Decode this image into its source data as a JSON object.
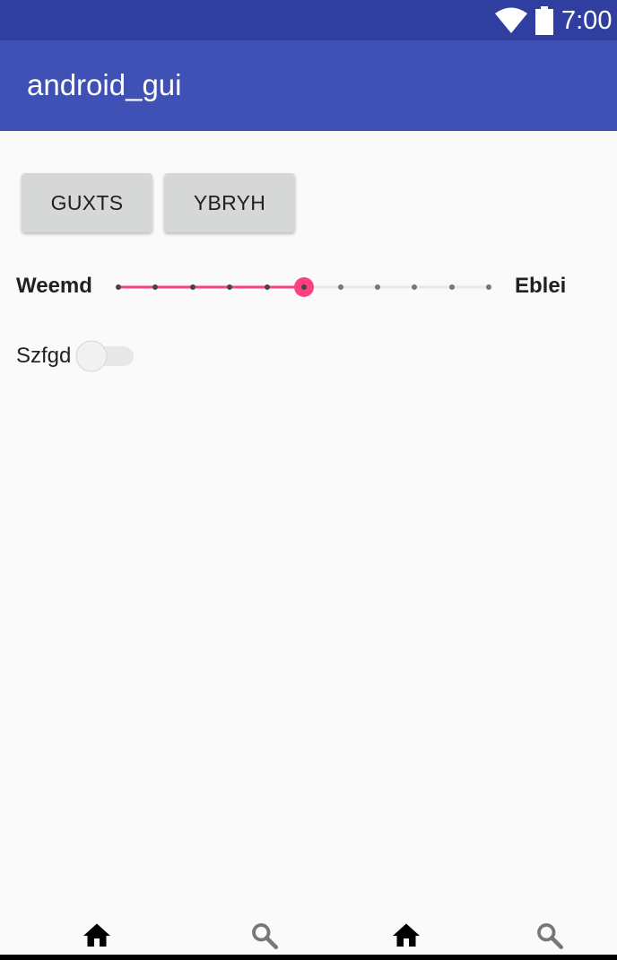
{
  "status_bar": {
    "time": "7:00",
    "icons": [
      "wifi-icon",
      "battery-icon"
    ]
  },
  "app_bar": {
    "title": "android_gui"
  },
  "buttons": [
    {
      "label": "GUXTS"
    },
    {
      "label": "YBRYH"
    }
  ],
  "slider": {
    "min_label": "Weemd",
    "max_label": "Eblei",
    "steps": 10,
    "value": 5,
    "accent_color": "#ff4081"
  },
  "switch": {
    "label": "Szfgd",
    "checked": false
  },
  "bottom_nav": {
    "items": [
      "home-icon",
      "search-icon",
      "home-icon",
      "search-icon"
    ]
  },
  "colors": {
    "status_bar": "#303f9f",
    "app_bar": "#3f51b5",
    "background": "#fafafa"
  }
}
